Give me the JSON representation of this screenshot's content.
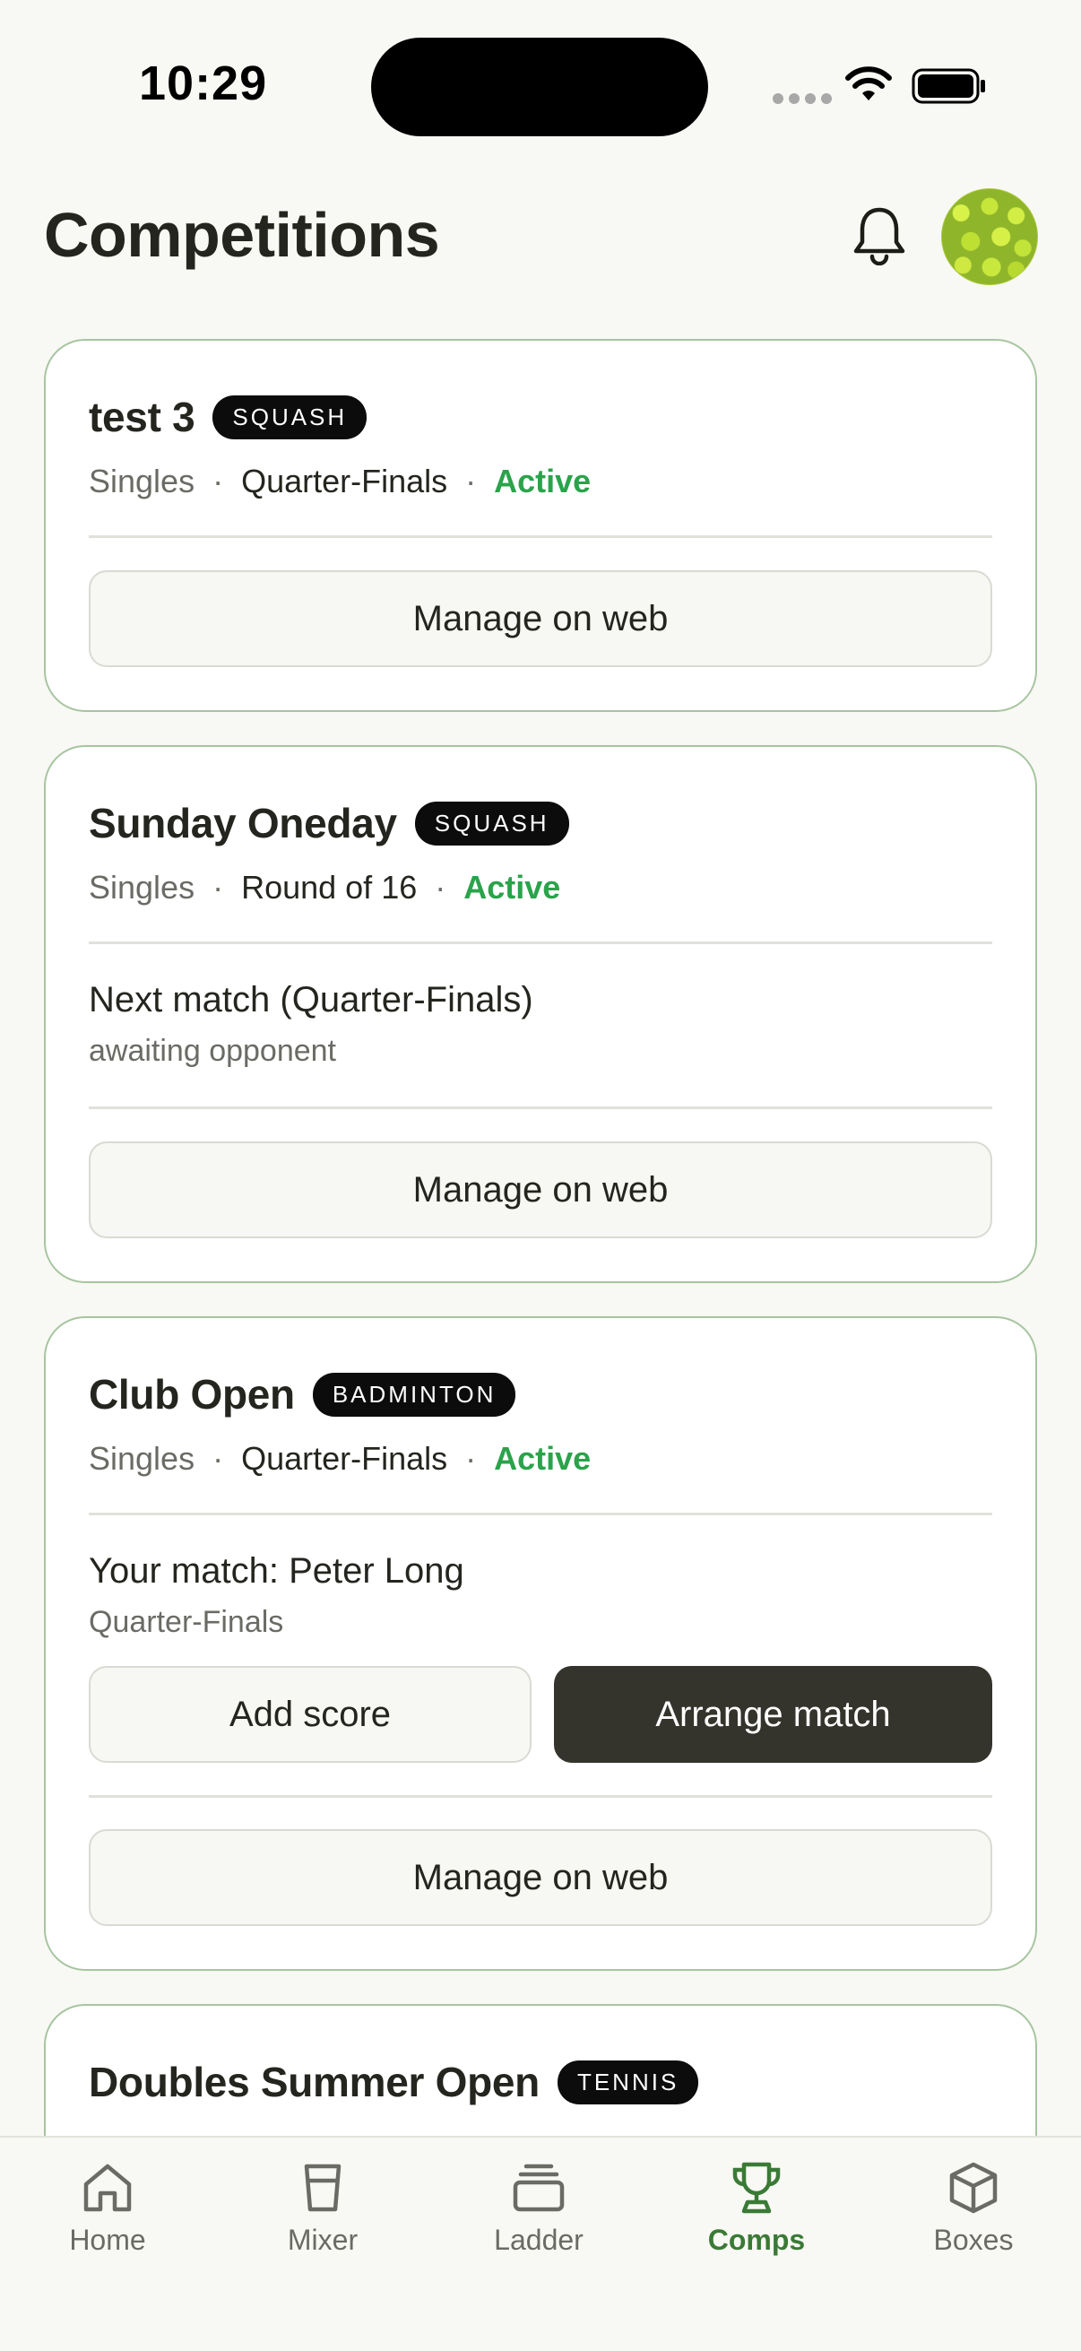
{
  "status_bar": {
    "time": "10:29"
  },
  "header": {
    "title": "Competitions"
  },
  "competitions": [
    {
      "name": "test 3",
      "sport": "SQUASH",
      "type": "Singles",
      "round": "Quarter-Finals",
      "status": "Active",
      "manage_label": "Manage on web"
    },
    {
      "name": "Sunday Oneday",
      "sport": "SQUASH",
      "type": "Singles",
      "round": "Round of 16",
      "status": "Active",
      "next_match_title": "Next match (Quarter-Finals)",
      "next_match_sub": "awaiting opponent",
      "manage_label": "Manage on web"
    },
    {
      "name": "Club Open",
      "sport": "BADMINTON",
      "type": "Singles",
      "round": "Quarter-Finals",
      "status": "Active",
      "match_title": "Your match: Peter Long",
      "match_sub": "Quarter-Finals",
      "add_score_label": "Add score",
      "arrange_label": "Arrange match",
      "manage_label": "Manage on web"
    },
    {
      "name": "Doubles Summer Open",
      "sport": "TENNIS"
    }
  ],
  "tabs": [
    {
      "label": "Home",
      "icon": "home-icon"
    },
    {
      "label": "Mixer",
      "icon": "glass-icon"
    },
    {
      "label": "Ladder",
      "icon": "stack-icon"
    },
    {
      "label": "Comps",
      "icon": "trophy-icon",
      "active": true
    },
    {
      "label": "Boxes",
      "icon": "box-icon"
    }
  ],
  "colors": {
    "background": "#f8f8f4",
    "card_border": "#a6c5a0",
    "active_status": "#2aa34a",
    "active_tab": "#3a7a36",
    "dark_button": "#34342c"
  }
}
